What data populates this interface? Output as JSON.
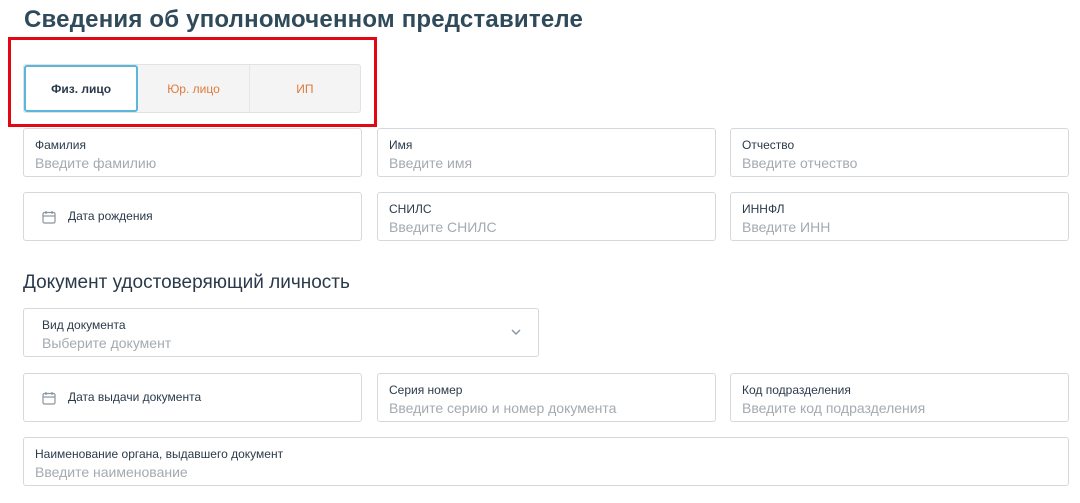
{
  "header": {
    "title": "Сведения об уполномоченном представителе"
  },
  "tabs": [
    {
      "label": "Физ. лицо",
      "active": true
    },
    {
      "label": "Юр. лицо",
      "active": false
    },
    {
      "label": "ИП",
      "active": false
    }
  ],
  "person": {
    "last_name": {
      "label": "Фамилия",
      "placeholder": "Введите фамилию"
    },
    "first_name": {
      "label": "Имя",
      "placeholder": "Введите имя"
    },
    "middle_name": {
      "label": "Отчество",
      "placeholder": "Введите отчество"
    },
    "birth_date": {
      "label": "Дата рождения"
    },
    "snils": {
      "label": "СНИЛС",
      "placeholder": "Введите СНИЛС"
    },
    "inn": {
      "label": "ИННФЛ",
      "placeholder": "Введите ИНН"
    }
  },
  "document": {
    "section_title": "Документ удостоверяющий личность",
    "doc_type": {
      "label": "Вид документа",
      "placeholder": "Выберите документ"
    },
    "issue_date": {
      "label": "Дата выдачи документа"
    },
    "series_number": {
      "label": "Серия номер",
      "placeholder": "Введите серию и номер документа"
    },
    "division_code": {
      "label": "Код подразделения",
      "placeholder": "Введите код подразделения"
    },
    "issuer": {
      "label": "Наименование органа, выдавшего документ",
      "placeholder": "Введите наименование"
    }
  },
  "colors": {
    "accent": "#5bb6dd",
    "tab_inactive": "#e07a3c",
    "highlight": "#e30613",
    "title": "#2f4a5a"
  }
}
